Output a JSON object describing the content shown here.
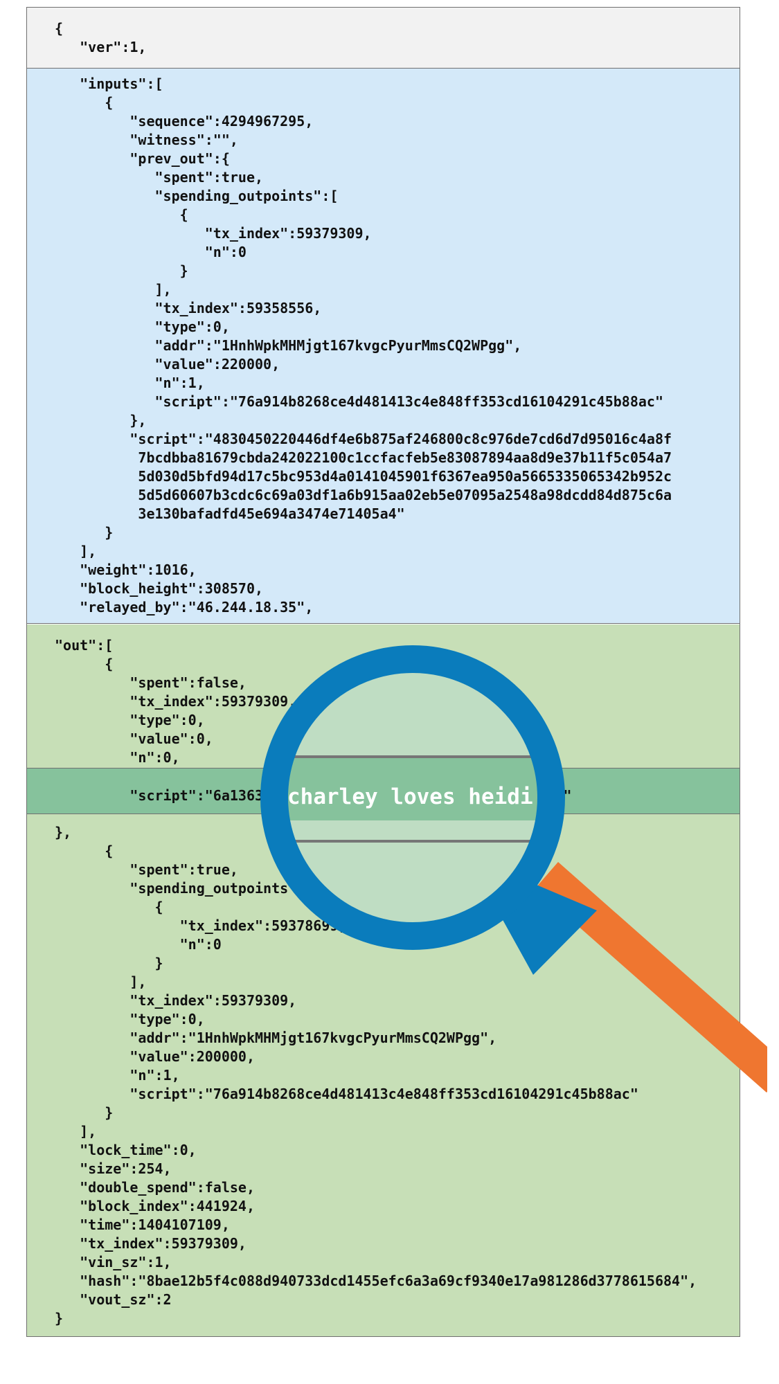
{
  "lines": [
    "{",
    "   \"ver\":1,",
    "   \"inputs\":[",
    "      {",
    "         \"sequence\":4294967295,",
    "         \"witness\":\"\",",
    "         \"prev_out\":{",
    "            \"spent\":true,",
    "            \"spending_outpoints\":[",
    "               {",
    "                  \"tx_index\":59379309,",
    "                  \"n\":0",
    "               }",
    "            ],",
    "            \"tx_index\":59358556,",
    "            \"type\":0,",
    "            \"addr\":\"1HnhWpkMHMjgt167kvgcPyurMmsCQ2WPgg\",",
    "            \"value\":220000,",
    "            \"n\":1,",
    "            \"script\":\"76a914b8268ce4d481413c4e848ff353cd16104291c45b88ac\"",
    "         },",
    "         \"script\":\"4830450220446df4e6b875af246800c8c976de7cd6d7d95016c4a8f",
    "          7bcdbba81679cbda242022100c1ccfacfeb5e83087894aa8d9e37b11f5c054a7",
    "          5d030d5bfd94d17c5bc953d4a0141045901f6367ea950a5665335065342b952c",
    "          5d5d60607b3cdc6c69a03df1a6b915aa02eb5e07095a2548a98dcdd84d875c6a",
    "          3e130bafadfd45e694a3474e71405a4\"",
    "      }",
    "   ],",
    "   \"weight\":1016,",
    "   \"block_height\":308570,",
    "   \"relayed_by\":\"46.244.18.35\",",
    "\"out\":[",
    "      {",
    "         \"spent\":false,",
    "         \"tx_index\":59379309,",
    "         \"type\":0,",
    "         \"value\":0,",
    "         \"n\":0,",
    "         \"script\":\"6a13636861726c6579206c6f766573206865696469\"",
    "},",
    "      {",
    "         \"spent\":true,",
    "         \"spending_outpoints\":[",
    "            {",
    "               \"tx_index\":59378699,",
    "               \"n\":0",
    "            }",
    "         ],",
    "         \"tx_index\":59379309,",
    "         \"type\":0,",
    "         \"addr\":\"1HnhWpkMHMjgt167kvgcPyurMmsCQ2WPgg\",",
    "         \"value\":200000,",
    "         \"n\":1,",
    "         \"script\":\"76a914b8268ce4d481413c4e848ff353cd16104291c45b88ac\"",
    "      }",
    "   ],",
    "   \"lock_time\":0,",
    "   \"size\":254,",
    "   \"double_spend\":false,",
    "   \"block_index\":441924,",
    "   \"time\":1404107109,",
    "   \"tx_index\":59379309,",
    "   \"vin_sz\":1,",
    "   \"hash\":\"8bae12b5f4c088d940733dcd1455efc6a3a69cf9340e17a981286d3778615684\",",
    "   \"vout_sz\":2",
    "}"
  ],
  "lens_text": "charley loves heidi",
  "colors": {
    "header_bg": "#f2f2f2",
    "inputs_bg": "#d4e9f9",
    "out_bg": "#c7dfb7",
    "highlight_bg": "#86c29c",
    "lens_ring": "#0a7cbc",
    "handle": "#ef7630"
  }
}
